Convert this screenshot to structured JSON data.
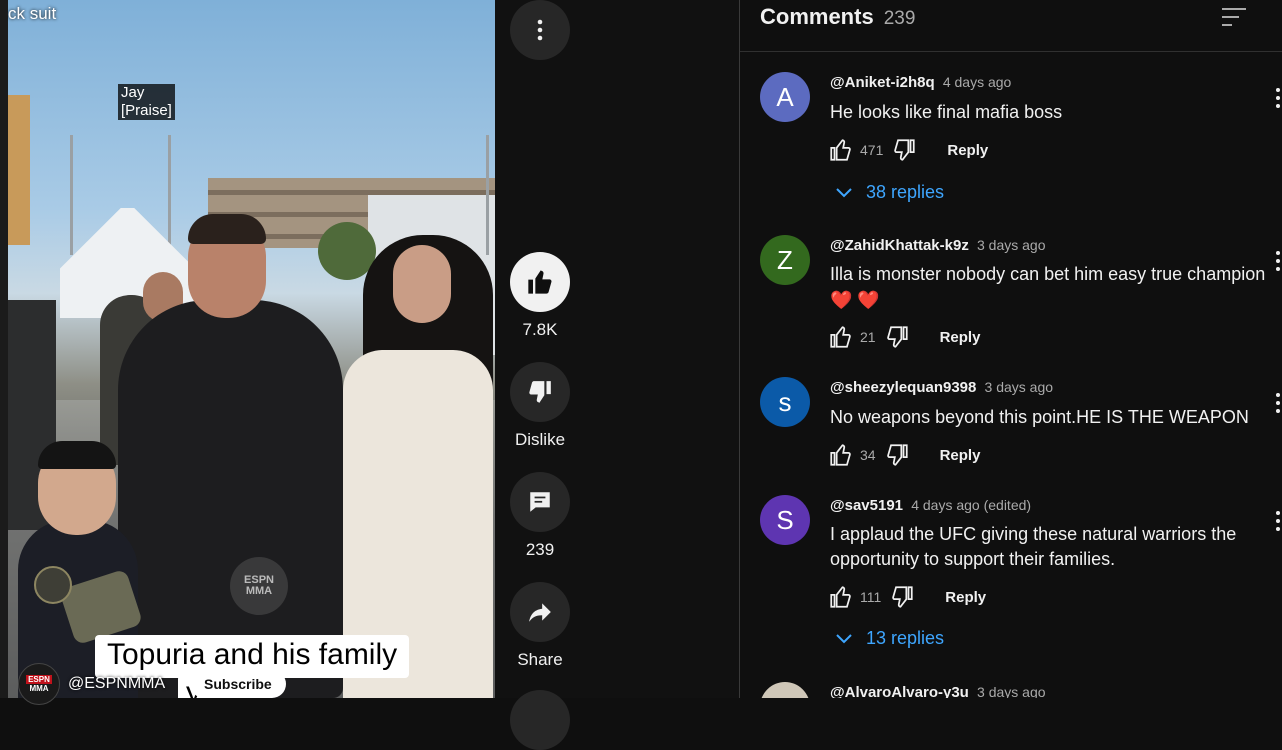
{
  "video": {
    "top_text": "ck suit",
    "caption_jay_line1": "Jay",
    "caption_jay_line2": "[Praise]",
    "big_caption_line1": "Topuria and his family",
    "big_caption_line2": "y 🔥",
    "watermark_line1": "ESPN",
    "watermark_line2": "MMA",
    "channel_avatar_top": "ESPN",
    "channel_avatar_bottom": "MMA",
    "channel_name": "@ESPNMMA",
    "subscribe_label": "Subscribe"
  },
  "actions": {
    "more_icon": "more-vert-icon",
    "like_count": "7.8K",
    "dislike_label": "Dislike",
    "comments_count": "239",
    "share_label": "Share"
  },
  "comments": {
    "title": "Comments",
    "count": "239",
    "items": [
      {
        "avatar_letter": "A",
        "avatar_color": "#5c6bc0",
        "handle": "@Aniket-i2h8q",
        "time": "4 days ago",
        "text": "He looks like final mafia boss",
        "likes": "471",
        "reply_label": "Reply",
        "replies": "38 replies"
      },
      {
        "avatar_letter": "Z",
        "avatar_color": "#33691e",
        "handle": "@ZahidKhattak-k9z",
        "time": "3 days ago",
        "text": "Illa is monster nobody can bet him easy true champion",
        "text_line2": "❤️ ❤️",
        "likes": "21",
        "reply_label": "Reply"
      },
      {
        "avatar_letter": "s",
        "avatar_color": "#0b5aa8",
        "handle": "@sheezylequan9398",
        "time": "3 days ago",
        "text": "No weapons beyond this point.HE IS THE WEAPON",
        "likes": "34",
        "reply_label": "Reply"
      },
      {
        "avatar_letter": "S",
        "avatar_color": "#5e35b1",
        "handle": "@sav5191",
        "time": "4 days ago (edited)",
        "text": "I applaud the UFC giving these natural warriors the",
        "text_line2": "opportunity to support their families.",
        "likes": "111",
        "reply_label": "Reply",
        "replies": "13 replies"
      },
      {
        "handle": "@AlvaroAlvaro-y3u",
        "time": "3 days ago"
      }
    ]
  }
}
